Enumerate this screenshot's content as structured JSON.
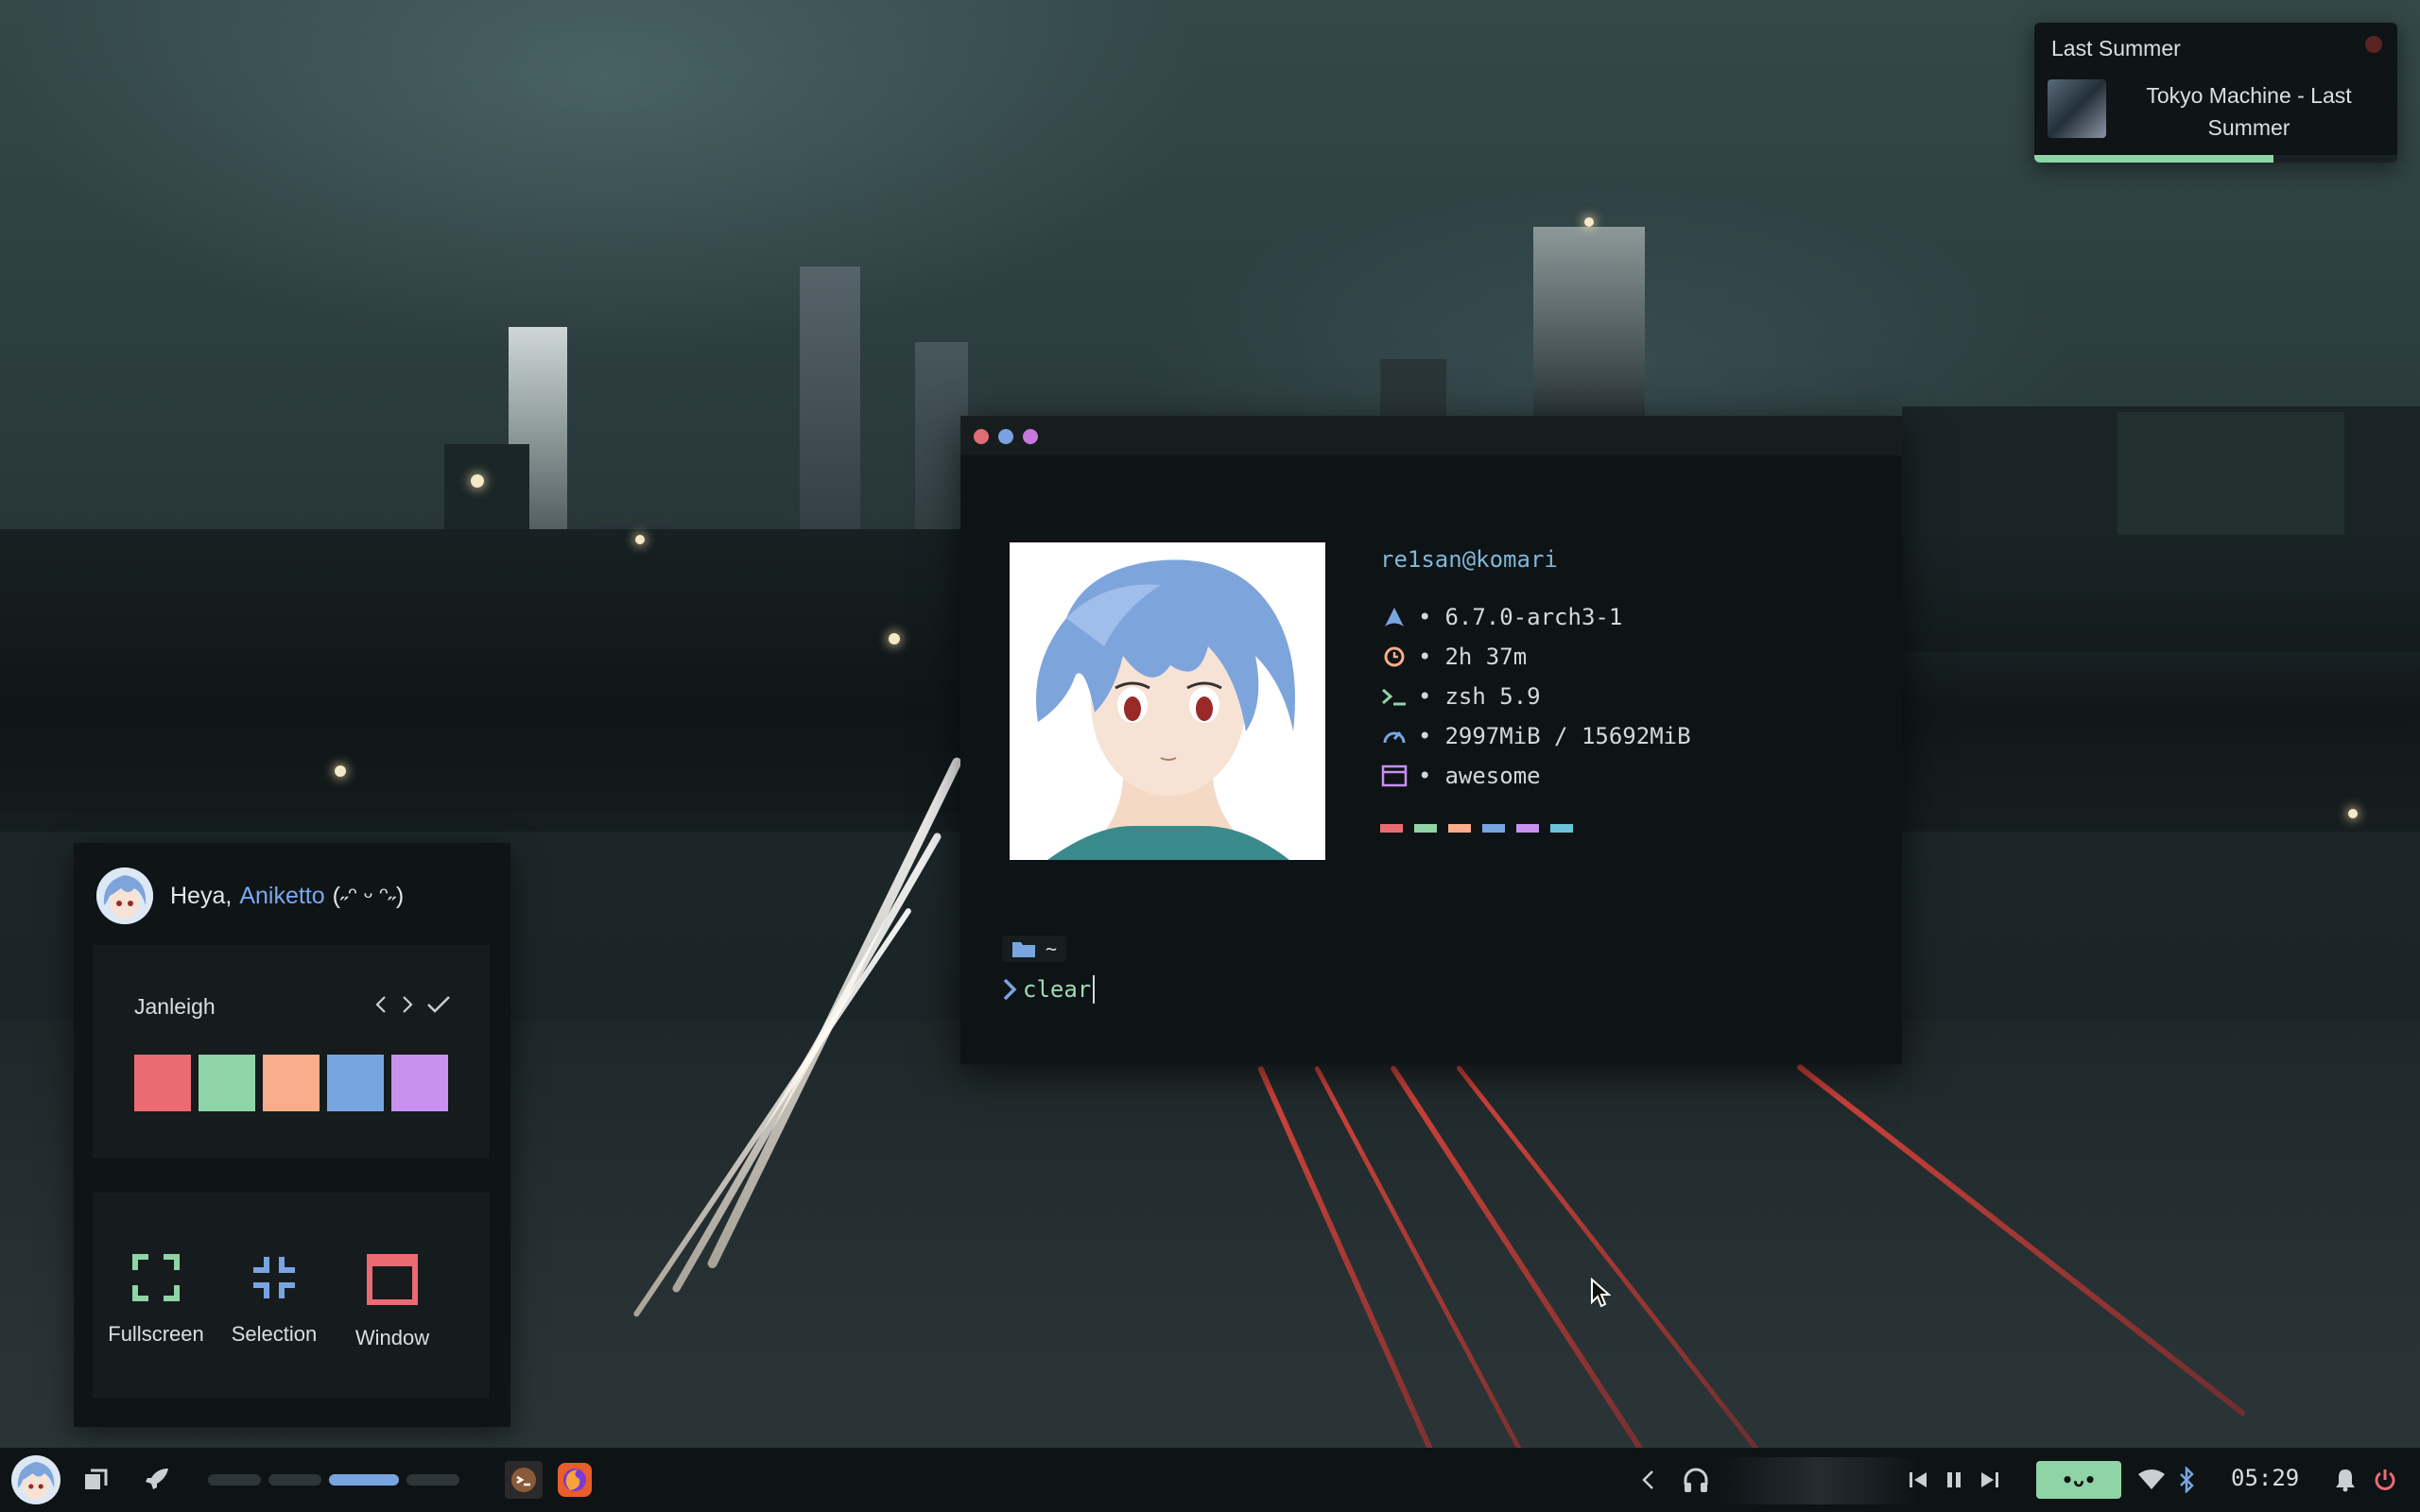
{
  "notification": {
    "title": "Last Summer",
    "body": "Tokyo Machine - Last Summer",
    "progress": 0.66,
    "close_color": "#5a2424"
  },
  "terminal": {
    "traffic_lights": [
      "#e06c75",
      "#7aa2e0",
      "#c678dd"
    ],
    "fetch": {
      "user": "re1san@komari",
      "rows": [
        {
          "icon": "arch-icon",
          "value": "6.7.0-arch3-1"
        },
        {
          "icon": "clock-icon",
          "value": "2h 37m"
        },
        {
          "icon": "terminal-prompt-icon",
          "value": "zsh 5.9"
        },
        {
          "icon": "speedometer-icon",
          "value": "2997MiB / 15692MiB"
        },
        {
          "icon": "window-icon",
          "value": "awesome"
        }
      ],
      "bullet": "•",
      "swatches": [
        "#e96b72",
        "#8fd4a6",
        "#f9ad8a",
        "#78a5e0",
        "#c791ef",
        "#6cc3d9"
      ]
    },
    "prompt": {
      "dir": "~",
      "command": "clear"
    }
  },
  "sidebar": {
    "greeting": {
      "prefix": "Heya,",
      "name": "Aniketto",
      "kaomoji": "(˶ᵔ ᵕ ᵔ˶)"
    },
    "theme": {
      "name": "Janleigh",
      "palette": [
        "#ea6b72",
        "#8fd4a6",
        "#f9ad8a",
        "#78a5e0",
        "#c791ef"
      ]
    },
    "screenshot": {
      "options": [
        {
          "label": "Fullscreen",
          "icon": "fullscreen-icon",
          "color": "#8fd4a6"
        },
        {
          "label": "Selection",
          "icon": "selection-icon",
          "color": "#78a5e0"
        },
        {
          "label": "Window",
          "icon": "window-frame-icon",
          "color": "#ea6b72"
        }
      ]
    }
  },
  "taskbar": {
    "tags": [
      {
        "active": false
      },
      {
        "active": false
      },
      {
        "active": true
      },
      {
        "active": false
      }
    ],
    "accent": "#78a5e0",
    "kaomoji": "•ᴗ•",
    "clock": "05:29"
  }
}
